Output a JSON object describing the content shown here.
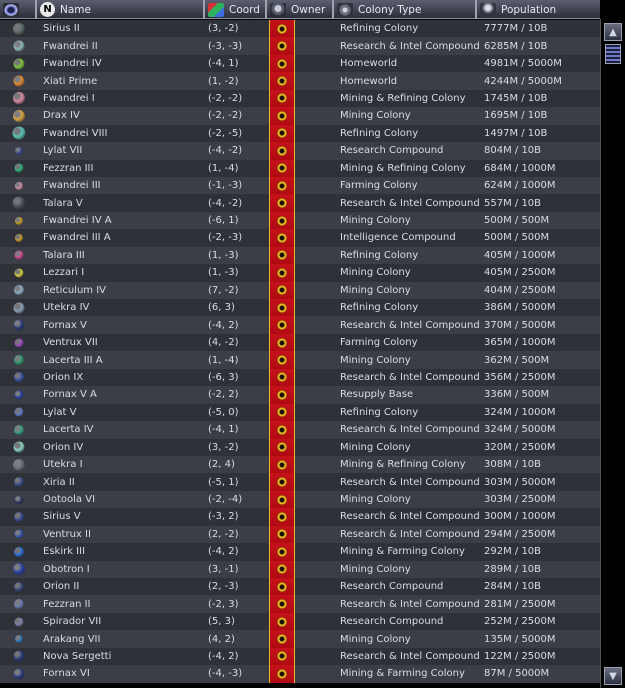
{
  "header": {
    "name_label": "Name",
    "coord_label": "Coord",
    "owner_label": "Owner",
    "type_label": "Colony Type",
    "pop_label": "Population",
    "n_glyph": "N"
  },
  "colonies": [
    {
      "name": "Sirius II",
      "coord": "(3, -2)",
      "type": "Refining Colony",
      "pop": "7777M / 10B",
      "planet": "#5d6b66"
    },
    {
      "name": "Fwandrei II",
      "coord": "(-3, -3)",
      "type": "Research & Intel Compound",
      "pop": "6285M / 10B",
      "planet": "#8fb7b2"
    },
    {
      "name": "Fwandrei IV",
      "coord": "(-4, 1)",
      "type": "Homeworld",
      "pop": "4981M / 5000M",
      "planet": "#7dc43c"
    },
    {
      "name": "Xiati Prime",
      "coord": "(1, -2)",
      "type": "Homeworld",
      "pop": "4244M / 5000M",
      "planet": "#e08a2c"
    },
    {
      "name": "Fwandrei I",
      "coord": "(-2, -2)",
      "type": "Mining & Refining Colony",
      "pop": "1745M / 10B",
      "planet": "#d98aa4"
    },
    {
      "name": "Drax IV",
      "coord": "(-2, -2)",
      "type": "Mining Colony",
      "pop": "1695M / 10B",
      "planet": "#d9a640"
    },
    {
      "name": "Fwandrei VIII",
      "coord": "(-2, -5)",
      "type": "Refining Colony",
      "pop": "1497M / 10B",
      "planet": "#5cc4b4"
    },
    {
      "name": "Lylat VII",
      "coord": "(-4, -2)",
      "type": "Research Compound",
      "pop": "804M / 10B",
      "planet": "#3a4c8a"
    },
    {
      "name": "Fezzran III",
      "coord": "(1, -4)",
      "type": "Mining & Refining Colony",
      "pop": "684M / 1000M",
      "planet": "#2fae78"
    },
    {
      "name": "Fwandrei III",
      "coord": "(-1, -3)",
      "type": "Farming Colony",
      "pop": "624M / 1000M",
      "planet": "#d08ea8"
    },
    {
      "name": "Talara V",
      "coord": "(-4, -2)",
      "type": "Research & Intel Compound",
      "pop": "557M / 10B",
      "planet": "#4a4f5c"
    },
    {
      "name": "Fwandrei IV A",
      "coord": "(-6, 1)",
      "type": "Mining Colony",
      "pop": "500M / 500M",
      "planet": "#c49a26"
    },
    {
      "name": "Fwandrei III A",
      "coord": "(-2, -3)",
      "type": "Intelligence Compound",
      "pop": "500M / 500M",
      "planet": "#c89c2a"
    },
    {
      "name": "Talara III",
      "coord": "(1, -3)",
      "type": "Refining Colony",
      "pop": "405M / 1000M",
      "planet": "#d04890"
    },
    {
      "name": "Lezzari I",
      "coord": "(1, -3)",
      "type": "Mining Colony",
      "pop": "405M / 2500M",
      "planet": "#d8d040"
    },
    {
      "name": "Reticulum IV",
      "coord": "(7, -2)",
      "type": "Mining Colony",
      "pop": "404M / 2500M",
      "planet": "#8fb0c8"
    },
    {
      "name": "Utekra IV",
      "coord": "(6, 3)",
      "type": "Refining Colony",
      "pop": "386M / 5000M",
      "planet": "#8aa0b8"
    },
    {
      "name": "Fornax V",
      "coord": "(-4, 2)",
      "type": "Research & Intel Compound",
      "pop": "370M / 5000M",
      "planet": "#2c3e78"
    },
    {
      "name": "Ventrux VII",
      "coord": "(4, -2)",
      "type": "Farming Colony",
      "pop": "365M / 1000M",
      "planet": "#9a4ac0"
    },
    {
      "name": "Lacerta III A",
      "coord": "(1, -4)",
      "type": "Mining Colony",
      "pop": "362M / 500M",
      "planet": "#2f9e6c"
    },
    {
      "name": "Orion IX",
      "coord": "(-6, 3)",
      "type": "Research & Intel Compound",
      "pop": "356M / 2500M",
      "planet": "#3c58a8"
    },
    {
      "name": "Fornax V A",
      "coord": "(-2, 2)",
      "type": "Resupply Base",
      "pop": "336M / 500M",
      "planet": "#2a44a0"
    },
    {
      "name": "Lylat V",
      "coord": "(-5, 0)",
      "type": "Refining Colony",
      "pop": "324M / 1000M",
      "planet": "#6078c8"
    },
    {
      "name": "Lacerta IV",
      "coord": "(-4, 1)",
      "type": "Research & Intel Compound",
      "pop": "324M / 5000M",
      "planet": "#3ca082"
    },
    {
      "name": "Orion IV",
      "coord": "(3, -2)",
      "type": "Mining Colony",
      "pop": "320M / 2500M",
      "planet": "#8ad0c0"
    },
    {
      "name": "Utekra I",
      "coord": "(2, 4)",
      "type": "Mining & Refining Colony",
      "pop": "308M / 10B",
      "planet": "#6c6f78"
    },
    {
      "name": "Xiria II",
      "coord": "(-5, 1)",
      "type": "Research & Intel Compound",
      "pop": "303M / 5000M",
      "planet": "#3a4e88"
    },
    {
      "name": "Ootoola VI",
      "coord": "(-2, -4)",
      "type": "Mining Colony",
      "pop": "303M / 2500M",
      "planet": "#2c3a62"
    },
    {
      "name": "Sirius V",
      "coord": "(-3, 2)",
      "type": "Research & Intel Compound",
      "pop": "300M / 1000M",
      "planet": "#3c4c90"
    },
    {
      "name": "Ventrux II",
      "coord": "(2, -2)",
      "type": "Research & Intel Compound",
      "pop": "294M / 2500M",
      "planet": "#3a58b0"
    },
    {
      "name": "Eskirk III",
      "coord": "(-4, 2)",
      "type": "Mining & Farming Colony",
      "pop": "292M / 10B",
      "planet": "#2f70d8"
    },
    {
      "name": "Obotron I",
      "coord": "(3, -1)",
      "type": "Mining Colony",
      "pop": "289M / 10B",
      "planet": "#2a42a8"
    },
    {
      "name": "Orion II",
      "coord": "(2, -3)",
      "type": "Research Compound",
      "pop": "284M / 10B",
      "planet": "#3a4a7a"
    },
    {
      "name": "Fezzran II",
      "coord": "(-2, 3)",
      "type": "Research & Intel Compound",
      "pop": "281M / 2500M",
      "planet": "#6a78b0"
    },
    {
      "name": "Spirador VII",
      "coord": "(5, 3)",
      "type": "Research Compound",
      "pop": "252M / 2500M",
      "planet": "#7f86b4"
    },
    {
      "name": "Arakang VII",
      "coord": "(4, 2)",
      "type": "Mining Colony",
      "pop": "135M / 5000M",
      "planet": "#2f7ab8"
    },
    {
      "name": "Nova Sergetti",
      "coord": "(-4, 2)",
      "type": "Research & Intel Compound",
      "pop": "122M / 2500M",
      "planet": "#2b3a7e"
    },
    {
      "name": "Fornax VI",
      "coord": "(-4, -3)",
      "type": "Mining & Farming Colony",
      "pop": "87M / 5000M",
      "planet": "#2f3c80"
    }
  ],
  "colors": {
    "owner_bg": "#c5121a",
    "owner_border": "#e8b830",
    "row_odd": "#2e3138",
    "row_even": "#3b3e46"
  }
}
